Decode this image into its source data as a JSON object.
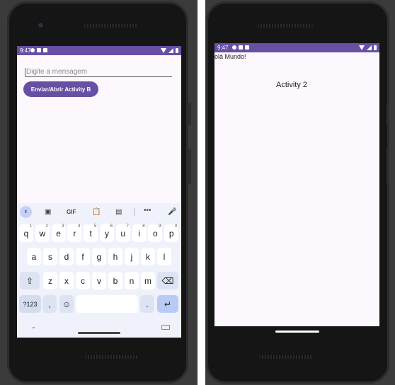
{
  "left_phone": {
    "status": {
      "time": "9:47"
    },
    "message_input": {
      "placeholder": "Digite a mensagem",
      "value": ""
    },
    "send_button": {
      "label": "Enviar/Abrir Activity B"
    },
    "keyboard": {
      "toolbar": {
        "gif_label": "GIF",
        "more_label": "•••"
      },
      "row1": [
        {
          "k": "q",
          "h": "1"
        },
        {
          "k": "w",
          "h": "2"
        },
        {
          "k": "e",
          "h": "3"
        },
        {
          "k": "r",
          "h": "4"
        },
        {
          "k": "t",
          "h": "5"
        },
        {
          "k": "y",
          "h": "6"
        },
        {
          "k": "u",
          "h": "7"
        },
        {
          "k": "i",
          "h": "8"
        },
        {
          "k": "o",
          "h": "9"
        },
        {
          "k": "p",
          "h": "0"
        }
      ],
      "row2": [
        "a",
        "s",
        "d",
        "f",
        "g",
        "h",
        "j",
        "k",
        "l"
      ],
      "row3": [
        "z",
        "x",
        "c",
        "v",
        "b",
        "n",
        "m"
      ],
      "symbols_label": "?123",
      "comma_label": ",",
      "period_label": ".",
      "shift_glyph": "⇧",
      "backspace_glyph": "⌫",
      "emoji_glyph": "☺",
      "enter_glyph": "↵"
    }
  },
  "right_phone": {
    "status": {
      "time": "9:47"
    },
    "hello_text": "olá Mundo!",
    "activity_label": "Activity 2"
  },
  "colors": {
    "accent": "#6750a4",
    "screen_bg": "#fdf8fd",
    "keyboard_bg": "#f0f2fb"
  }
}
